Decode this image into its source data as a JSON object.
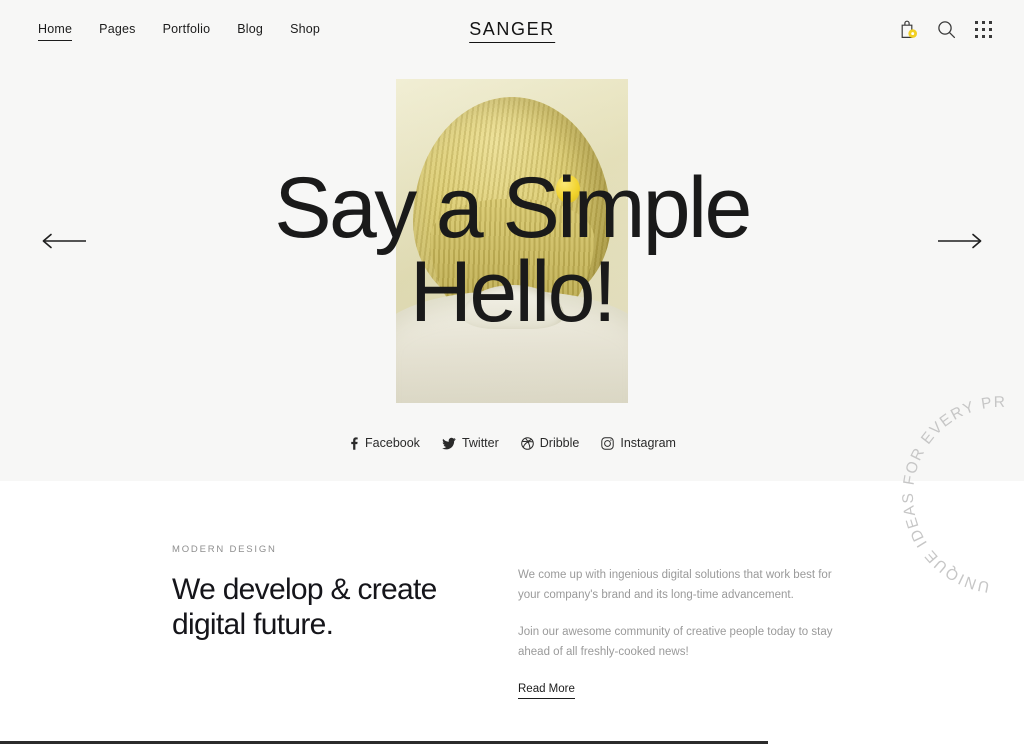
{
  "header": {
    "logo": "SANGER",
    "nav": [
      {
        "label": "Home",
        "active": true
      },
      {
        "label": "Pages",
        "active": false
      },
      {
        "label": "Portfolio",
        "active": false
      },
      {
        "label": "Blog",
        "active": false
      },
      {
        "label": "Shop",
        "active": false
      }
    ],
    "icons": [
      {
        "name": "shopping-bag-icon",
        "badge_color": "#f2d024"
      },
      {
        "name": "search-icon"
      },
      {
        "name": "grid-menu-icon"
      }
    ]
  },
  "hero": {
    "title_line1": "Say a Simple",
    "title_line2": "Hello!",
    "prev_label": "Previous slide",
    "next_label": "Next slide",
    "social": [
      {
        "label": "Facebook",
        "icon": "facebook-icon"
      },
      {
        "label": "Twitter",
        "icon": "twitter-icon"
      },
      {
        "label": "Dribble",
        "icon": "dribble-icon"
      },
      {
        "label": "Instagram",
        "icon": "instagram-icon"
      }
    ]
  },
  "badge": {
    "text": "UNIQUE IDEAS FOR EVERY PROJECT. "
  },
  "intro": {
    "eyebrow": "MODERN DESIGN",
    "heading_line1": "We develop & create",
    "heading_line2": "digital future.",
    "paragraph1": "We come up with ingenious digital solutions that work best for your company's brand and its long-time advancement.",
    "paragraph2": "Join our awesome community of creative people today to stay ahead of all freshly-cooked news!",
    "read_more": "Read More"
  },
  "colors": {
    "hero_bg": "#f7f7f6",
    "text_dark": "#1a1a1a",
    "muted": "#9a9a9a",
    "accent_yellow": "#f2d024"
  }
}
